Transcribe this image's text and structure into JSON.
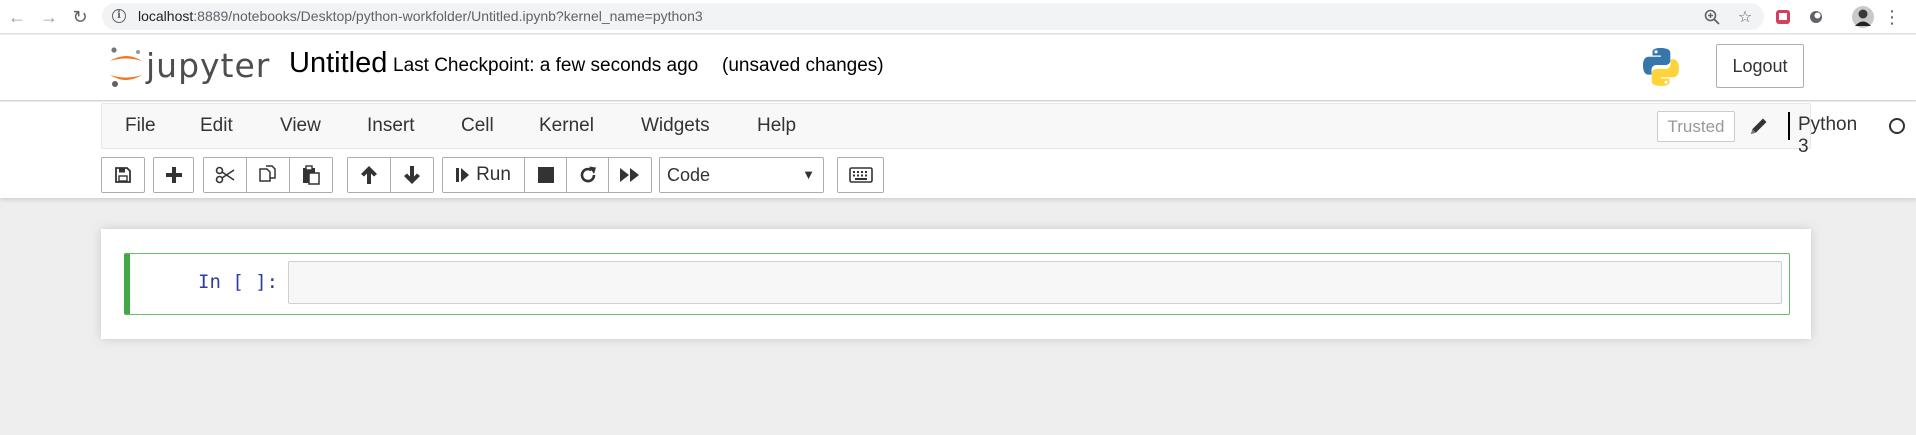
{
  "browser": {
    "url_host": "localhost",
    "url_rest": ":8889/notebooks/Desktop/python-workfolder/Untitled.ipynb?kernel_name=python3"
  },
  "header": {
    "logo_text": "jupyter",
    "notebook_title": "Untitled",
    "checkpoint": "Last Checkpoint: a few seconds ago",
    "autosave_status": "(unsaved changes)",
    "logout_label": "Logout"
  },
  "menu": {
    "items": [
      "File",
      "Edit",
      "View",
      "Insert",
      "Cell",
      "Kernel",
      "Widgets",
      "Help"
    ],
    "trusted_label": "Trusted",
    "kernel_name": "Python 3"
  },
  "toolbar": {
    "run_label": "Run",
    "cell_type": "Code"
  },
  "cell": {
    "prompt": "In [ ]:",
    "code": ""
  },
  "colors": {
    "cell_border": "#66bb6a",
    "cell_left_bar": "#42a845",
    "prompt_blue": "#303f9f",
    "jupyter_orange": "#f37726"
  }
}
